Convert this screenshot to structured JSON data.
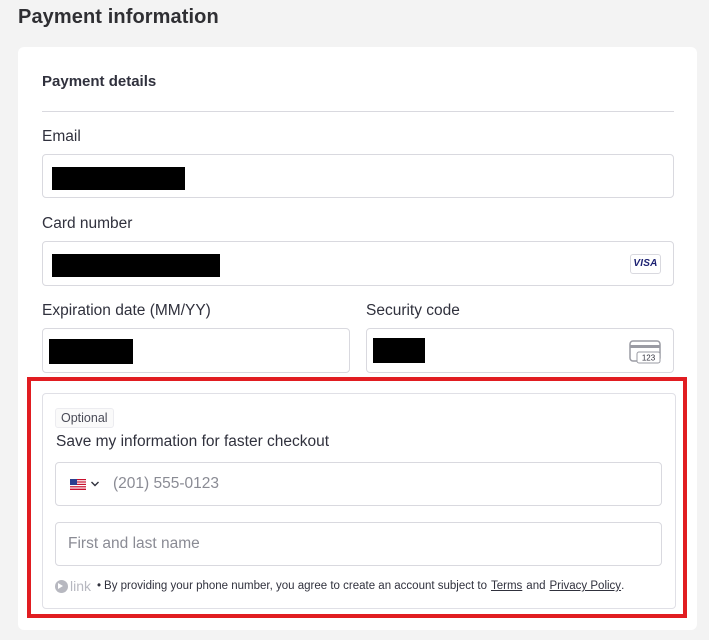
{
  "page": {
    "title": "Payment information"
  },
  "payment_details": {
    "title": "Payment details",
    "email": {
      "label": "Email",
      "value": ""
    },
    "card_number": {
      "label": "Card number",
      "value": "",
      "brand_badge": "VISA"
    },
    "expiration": {
      "label": "Expiration date (MM/YY)",
      "value": ""
    },
    "security_code": {
      "label": "Security code",
      "value": "",
      "icon": "card-cvc-icon",
      "icon_text": "123"
    }
  },
  "link_section": {
    "optional_tag": "Optional",
    "save_text": "Save my information for faster checkout",
    "phone": {
      "placeholder": "(201) 555-0123",
      "country_flag": "us-flag-icon"
    },
    "name": {
      "placeholder": "First and last name"
    },
    "footer": {
      "logo_text": "link",
      "bullet": "•",
      "prefix": "By providing your phone number, you agree to create an account subject to",
      "terms": "Terms",
      "and": "and",
      "privacy": "Privacy Policy",
      "suffix": "."
    }
  },
  "colors": {
    "highlight": "#e11d21",
    "visa": "#1a1f71",
    "background": "#f3f3f3"
  }
}
